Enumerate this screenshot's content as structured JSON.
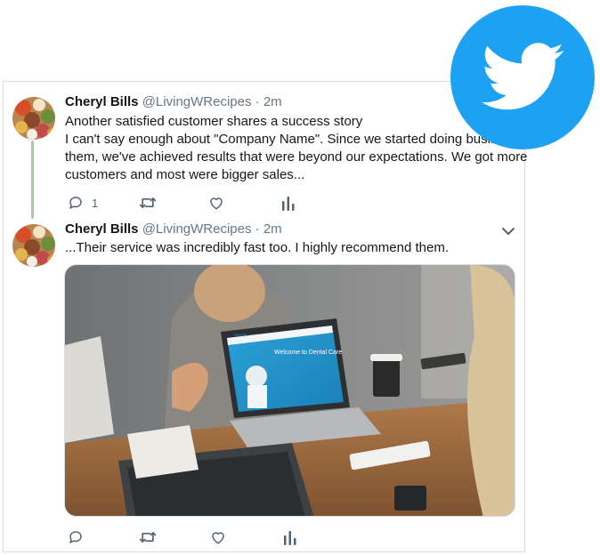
{
  "tweets": [
    {
      "name": "Cheryl Bills",
      "handle": "@LivingWRecipes",
      "time": "· 2m",
      "lines": [
        "Another satisfied customer shares a success story",
        "I can't say enough about \"Company Name\". Since we started doing business with",
        "them, we've achieved results that were beyond our expectations. We got more",
        "customers and most were bigger sales..."
      ],
      "reply_count": "1"
    },
    {
      "name": "Cheryl Bills",
      "handle": "@LivingWRecipes",
      "time": "· 2m",
      "lines": [
        "...Their service was incredibly fast too. I highly recommend them."
      ],
      "reply_count": ""
    }
  ],
  "media": {
    "screen_title": "Welcome to Dental Care",
    "screen_brand": "DENTAL"
  },
  "colors": {
    "twitter_blue": "#1da1f2",
    "thread_line": "#a8cfa0",
    "action_gray": "#536471"
  },
  "icons": [
    "reply-icon",
    "retweet-icon",
    "like-icon",
    "analytics-icon",
    "chevron-down-icon",
    "twitter-bird-logo"
  ]
}
